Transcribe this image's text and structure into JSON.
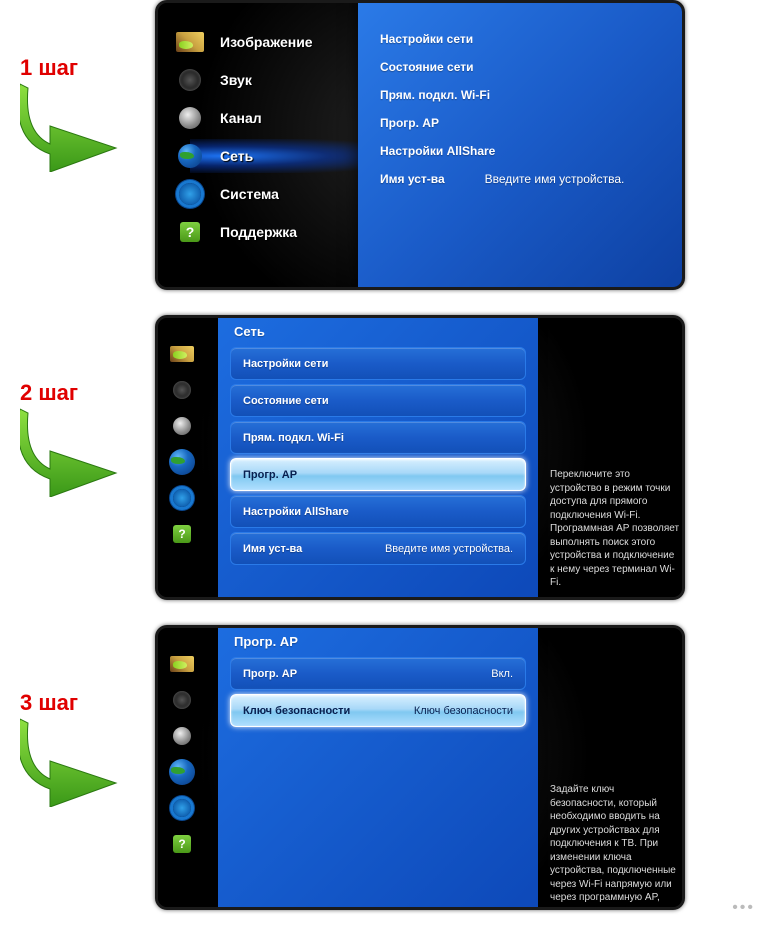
{
  "steps": {
    "s1": {
      "label": "1 шаг"
    },
    "s2": {
      "label": "2 шаг"
    },
    "s3": {
      "label": "3 шаг"
    }
  },
  "main_menu": {
    "items": [
      {
        "label": "Изображение"
      },
      {
        "label": "Звук"
      },
      {
        "label": "Канал"
      },
      {
        "label": "Сеть"
      },
      {
        "label": "Система"
      },
      {
        "label": "Поддержка"
      }
    ]
  },
  "network_submenu": {
    "title": "Сеть",
    "items": [
      {
        "label": "Настройки сети"
      },
      {
        "label": "Состояние сети"
      },
      {
        "label": "Прям. подкл. Wi-Fi"
      },
      {
        "label": "Прогр. AP"
      },
      {
        "label": "Настройки AllShare"
      },
      {
        "label": "Имя уст-ва",
        "value": "Введите имя устройства."
      }
    ]
  },
  "step2_help": "Переключите это устройство в режим точки доступа для прямого подключения Wi-Fi. Программная AP позволяет выполнять поиск этого устройства и подключение к нему через терминал Wi-Fi.",
  "step3_panel": {
    "title": "Прогр. AP",
    "items": [
      {
        "label": "Прогр. AP",
        "value": "Вкл."
      },
      {
        "label": "Ключ безопасности",
        "value": "Ключ безопасности"
      }
    ]
  },
  "step3_help": "Задайте ключ безопасности, который необходимо вводить на других устройствах для подключения к ТВ. При изменении ключа устройства, подключенные через Wi-Fi напрямую или через программную AP,"
}
